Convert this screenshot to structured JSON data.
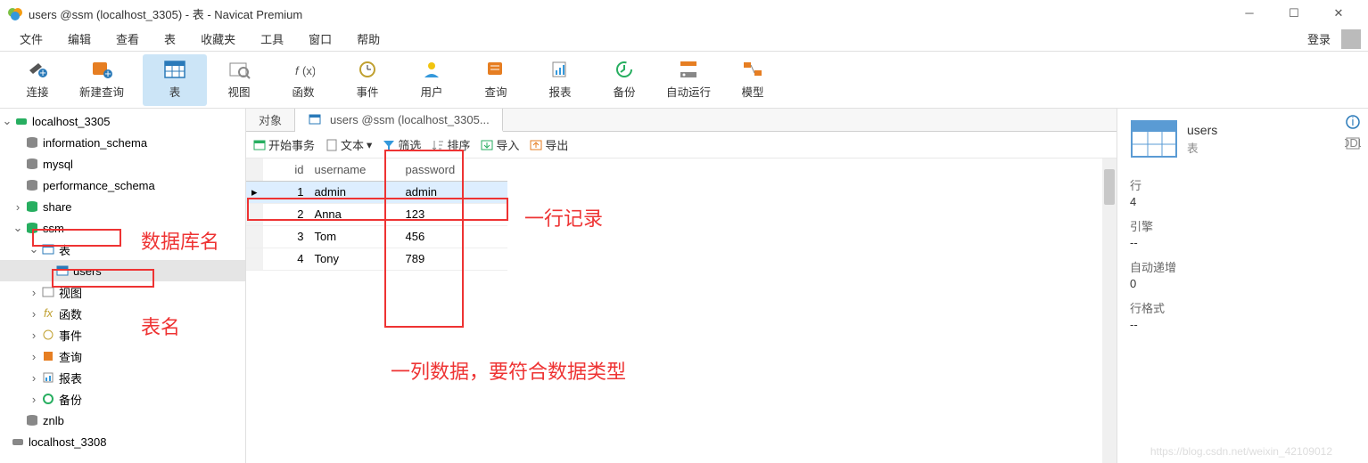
{
  "window": {
    "title": "users @ssm (localhost_3305) - 表 - Navicat Premium"
  },
  "menu": {
    "items": [
      "文件",
      "编辑",
      "查看",
      "表",
      "收藏夹",
      "工具",
      "窗口",
      "帮助"
    ],
    "login": "登录"
  },
  "toolbar": {
    "items": [
      "连接",
      "新建查询",
      "表",
      "视图",
      "函数",
      "事件",
      "用户",
      "查询",
      "报表",
      "备份",
      "自动运行",
      "模型"
    ],
    "active_index": 2
  },
  "tree": {
    "conn1": "localhost_3305",
    "dbs": [
      "information_schema",
      "mysql",
      "performance_schema",
      "share",
      "ssm"
    ],
    "ssm_nodes": {
      "tables": "表",
      "users": "users",
      "views": "视图",
      "functions": "函数",
      "events": "事件",
      "queries": "查询",
      "reports": "报表",
      "backups": "备份"
    },
    "znlb": "znlb",
    "conn2": "localhost_3308"
  },
  "tabs": {
    "object": "对象",
    "users": "users @ssm (localhost_3305..."
  },
  "subtoolbar": {
    "begin_tx": "开始事务",
    "text": "文本",
    "filter": "筛选",
    "sort": "排序",
    "import": "导入",
    "export": "导出"
  },
  "grid": {
    "headers": {
      "id": "id",
      "username": "username",
      "password": "password"
    },
    "rows": [
      {
        "id": "1",
        "username": "admin",
        "password": "admin"
      },
      {
        "id": "2",
        "username": "Anna",
        "password": "123"
      },
      {
        "id": "3",
        "username": "Tom",
        "password": "456"
      },
      {
        "id": "4",
        "username": "Tony",
        "password": "789"
      }
    ]
  },
  "rightpanel": {
    "name": "users",
    "type": "表",
    "props": {
      "rows_label": "行",
      "rows_value": "4",
      "engine_label": "引擎",
      "engine_value": "--",
      "autoinc_label": "自动递增",
      "autoinc_value": "0",
      "rowfmt_label": "行格式",
      "rowfmt_value": "--"
    }
  },
  "annotations": {
    "db_name": "数据库名",
    "table_name": "表名",
    "row_record": "一行记录",
    "col_data": "一列数据，要符合数据类型"
  },
  "watermark": "https://blog.csdn.net/weixin_42109012"
}
